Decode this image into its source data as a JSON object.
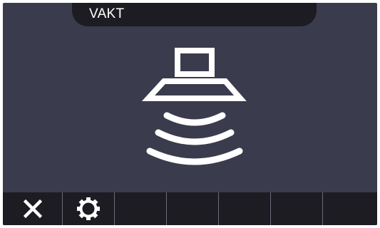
{
  "header": {
    "title": "VAKT"
  },
  "main": {
    "status_icon": "hood-fan-icon"
  },
  "toolbar": {
    "buttons": [
      {
        "icon": "close-icon"
      },
      {
        "icon": "settings-icon"
      },
      {
        "icon": ""
      },
      {
        "icon": ""
      },
      {
        "icon": ""
      },
      {
        "icon": ""
      },
      {
        "icon": ""
      }
    ]
  },
  "colors": {
    "background": "#3a3c4d",
    "bar": "#1c1c22",
    "foreground": "#ffffff",
    "divider": "#6a6c78"
  }
}
